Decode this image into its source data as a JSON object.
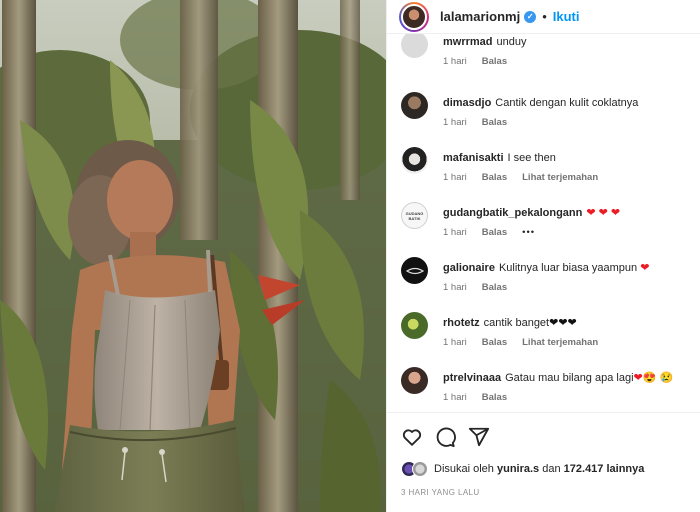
{
  "post": {
    "username": "lalamarionmj",
    "follow_label": "Ikuti",
    "separator": "•",
    "likes_prefix": "Disukai oleh",
    "likes_user": "yunira.s",
    "likes_and": "dan",
    "likes_count": "172.417",
    "likes_suffix": "lainnya",
    "date": "3 HARI YANG LALU"
  },
  "comments": [
    {
      "username": "mwrrmad",
      "text": "unduy",
      "time": "1 hari",
      "reply": "Balas",
      "extra": ""
    },
    {
      "username": "dimasdjo",
      "text": "Cantik dengan kulit coklatnya",
      "time": "1 hari",
      "reply": "Balas",
      "extra": ""
    },
    {
      "username": "mafanisakti",
      "text": "I see then",
      "time": "1 hari",
      "reply": "Balas",
      "extra": "Lihat terjemahan"
    },
    {
      "username": "gudangbatik_pekalongann",
      "text": "",
      "time": "1 hari",
      "reply": "Balas",
      "extra": "•••"
    },
    {
      "username": "galionaire",
      "text": "Kulitnya luar biasa yaampun",
      "time": "1 hari",
      "reply": "Balas",
      "extra": ""
    },
    {
      "username": "rhotetz",
      "text": "cantik banget",
      "time": "1 hari",
      "reply": "Balas",
      "extra": "Lihat terjemahan"
    },
    {
      "username": "ptrelvinaaa",
      "text": "Gatau mau bilang apa lagi",
      "time": "1 hari",
      "reply": "Balas",
      "extra": ""
    }
  ],
  "emoji": {
    "red_hearts": "❤ ❤ ❤",
    "red_heart": "❤",
    "black_hearts": "❤❤❤",
    "last_emojis": "😍 😢"
  },
  "avatar_logo_text": "GUDANG BATIK",
  "colors": {
    "accent": "#0095f6",
    "verified": "#3897f0",
    "text": "#262626",
    "meta": "#737373"
  },
  "icons": [
    "heart-icon",
    "comment-icon",
    "share-icon"
  ]
}
